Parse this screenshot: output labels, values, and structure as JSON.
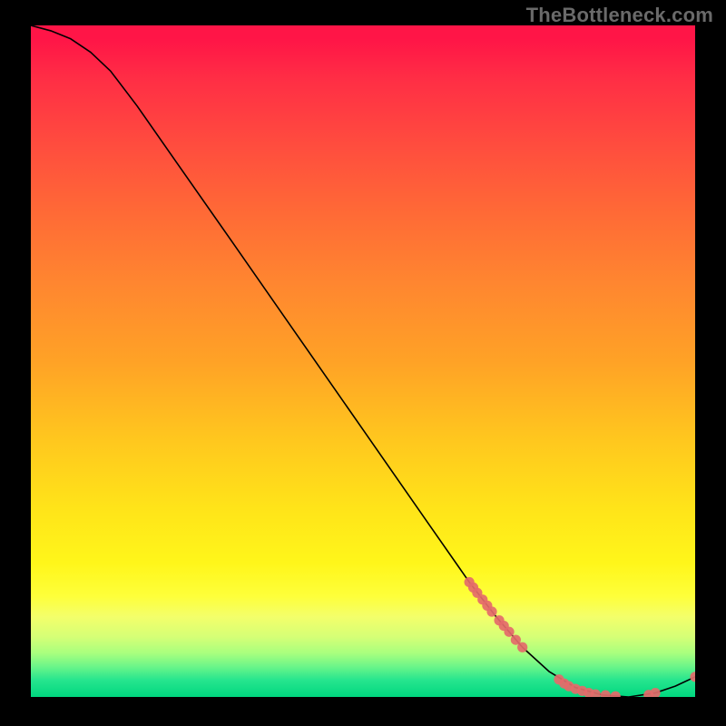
{
  "watermark": "TheBottleneck.com",
  "chart_data": {
    "type": "line",
    "title": "",
    "xlabel": "",
    "ylabel": "",
    "xlim": [
      0,
      100
    ],
    "ylim": [
      0,
      100
    ],
    "grid": false,
    "curve": [
      {
        "x": 0,
        "y": 100
      },
      {
        "x": 3,
        "y": 99.2
      },
      {
        "x": 6,
        "y": 98.0
      },
      {
        "x": 9,
        "y": 96.0
      },
      {
        "x": 12,
        "y": 93.2
      },
      {
        "x": 16,
        "y": 88.0
      },
      {
        "x": 22,
        "y": 79.5
      },
      {
        "x": 30,
        "y": 68.2
      },
      {
        "x": 40,
        "y": 54.0
      },
      {
        "x": 50,
        "y": 39.8
      },
      {
        "x": 60,
        "y": 25.6
      },
      {
        "x": 66,
        "y": 17.1
      },
      {
        "x": 70,
        "y": 12.0
      },
      {
        "x": 74,
        "y": 7.4
      },
      {
        "x": 78,
        "y": 3.8
      },
      {
        "x": 82,
        "y": 1.4
      },
      {
        "x": 86,
        "y": 0.3
      },
      {
        "x": 90,
        "y": 0.0
      },
      {
        "x": 94,
        "y": 0.6
      },
      {
        "x": 97,
        "y": 1.6
      },
      {
        "x": 100,
        "y": 3.0
      }
    ],
    "marker_points": [
      {
        "x": 66.0,
        "y": 17.1
      },
      {
        "x": 66.6,
        "y": 16.3
      },
      {
        "x": 67.2,
        "y": 15.5
      },
      {
        "x": 68.0,
        "y": 14.5
      },
      {
        "x": 68.7,
        "y": 13.6
      },
      {
        "x": 69.4,
        "y": 12.7
      },
      {
        "x": 70.5,
        "y": 11.4
      },
      {
        "x": 71.2,
        "y": 10.6
      },
      {
        "x": 72.0,
        "y": 9.7
      },
      {
        "x": 73.0,
        "y": 8.5
      },
      {
        "x": 74.0,
        "y": 7.4
      },
      {
        "x": 79.5,
        "y": 2.6
      },
      {
        "x": 80.3,
        "y": 2.0
      },
      {
        "x": 81.0,
        "y": 1.6
      },
      {
        "x": 82.0,
        "y": 1.2
      },
      {
        "x": 83.0,
        "y": 0.9
      },
      {
        "x": 84.0,
        "y": 0.6
      },
      {
        "x": 85.0,
        "y": 0.4
      },
      {
        "x": 86.5,
        "y": 0.25
      },
      {
        "x": 88.0,
        "y": 0.1
      },
      {
        "x": 93.0,
        "y": 0.3
      },
      {
        "x": 94.0,
        "y": 0.6
      },
      {
        "x": 100.0,
        "y": 3.0
      }
    ],
    "marker_radius": 5.6,
    "colors": {
      "curve": "#000000",
      "marker": "#e46a6a",
      "gradient_top": "#ff1547",
      "gradient_bottom": "#00d77f"
    }
  }
}
